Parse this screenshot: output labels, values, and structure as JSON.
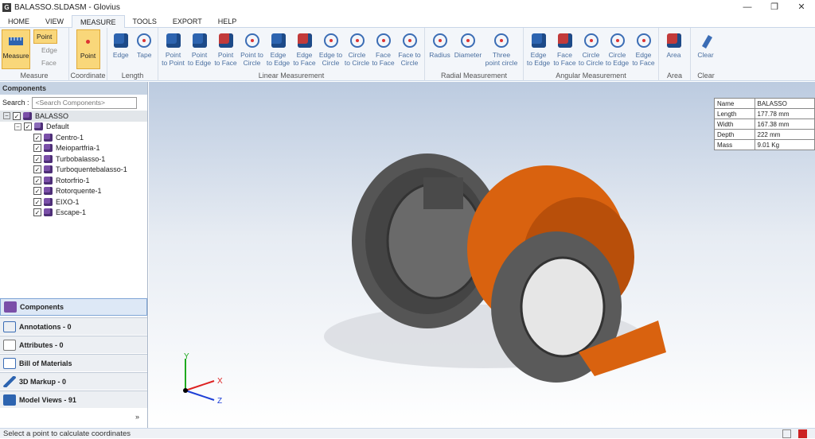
{
  "window": {
    "title": "BALASSO.SLDASM - Glovius",
    "app_icon": "G",
    "min": "—",
    "restore": "❐",
    "close": "✕"
  },
  "tabs": [
    {
      "label": "HOME"
    },
    {
      "label": "VIEW"
    },
    {
      "label": "MEASURE"
    },
    {
      "label": "TOOLS"
    },
    {
      "label": "EXPORT"
    },
    {
      "label": "HELP"
    }
  ],
  "ribbon": {
    "measure": {
      "label": "Measure",
      "options": [
        "Point",
        "Edge",
        "Face"
      ],
      "group": "Measure"
    },
    "coordinate": {
      "label": "Point",
      "group": "Coordinate"
    },
    "length": {
      "items": [
        "Edge",
        "Tape"
      ],
      "group": "Length"
    },
    "linear": {
      "items": [
        [
          "Point",
          "to Point"
        ],
        [
          "Point",
          "to Edge"
        ],
        [
          "Point",
          "to Face"
        ],
        [
          "Point to",
          "Circle"
        ],
        [
          "Edge",
          "to Edge"
        ],
        [
          "Edge",
          "to Face"
        ],
        [
          "Edge to",
          "Circle"
        ],
        [
          "Circle",
          "to Circle"
        ],
        [
          "Face",
          "to Face"
        ],
        [
          "Face to",
          "Circle"
        ]
      ],
      "group": "Linear Measurement"
    },
    "radial": {
      "items": [
        [
          "Radius",
          ""
        ],
        [
          "Diameter",
          ""
        ],
        [
          "Three",
          "point circle"
        ]
      ],
      "group": "Radial Measurement"
    },
    "angular": {
      "items": [
        [
          "Edge",
          "to Edge"
        ],
        [
          "Face",
          "to Face"
        ],
        [
          "Circle",
          "to Circle"
        ],
        [
          "Circle",
          "to Edge"
        ],
        [
          "Edge",
          "to Face"
        ]
      ],
      "group": "Angular Measurement"
    },
    "area": {
      "label": "Area",
      "group": "Area"
    },
    "clear": {
      "label": "Clear",
      "group": "Clear"
    }
  },
  "components": {
    "title": "Components",
    "search_label": "Search :",
    "search_placeholder": "<Search Components>",
    "root": "BALASSO",
    "config": "Default",
    "items": [
      "Centro-1",
      "Meiopartfria-1",
      "Turbobalasso-1",
      "Turboquentebalasso-1",
      "Rotorfrio-1",
      "Rotorquente-1",
      "EIXO-1",
      "Escape-1"
    ]
  },
  "nav": [
    {
      "label": "Components"
    },
    {
      "label": "Annotations - 0"
    },
    {
      "label": "Attributes - 0"
    },
    {
      "label": "Bill of Materials"
    },
    {
      "label": "3D Markup - 0"
    },
    {
      "label": "Model Views - 91"
    }
  ],
  "nav_more": "»",
  "properties": [
    [
      "Name",
      "BALASSO"
    ],
    [
      "Length",
      "177.78 mm"
    ],
    [
      "Width",
      "167.38 mm"
    ],
    [
      "Depth",
      "222 mm"
    ],
    [
      "Mass",
      "9.01 Kg"
    ]
  ],
  "axes": {
    "y": "Y",
    "x": "X",
    "z": "Z"
  },
  "status": "Select a point to calculate coordinates",
  "colors": {
    "accent": "#2d64b0",
    "orange": "#d9620f",
    "ribbon_bg": "#f3f6fa"
  }
}
